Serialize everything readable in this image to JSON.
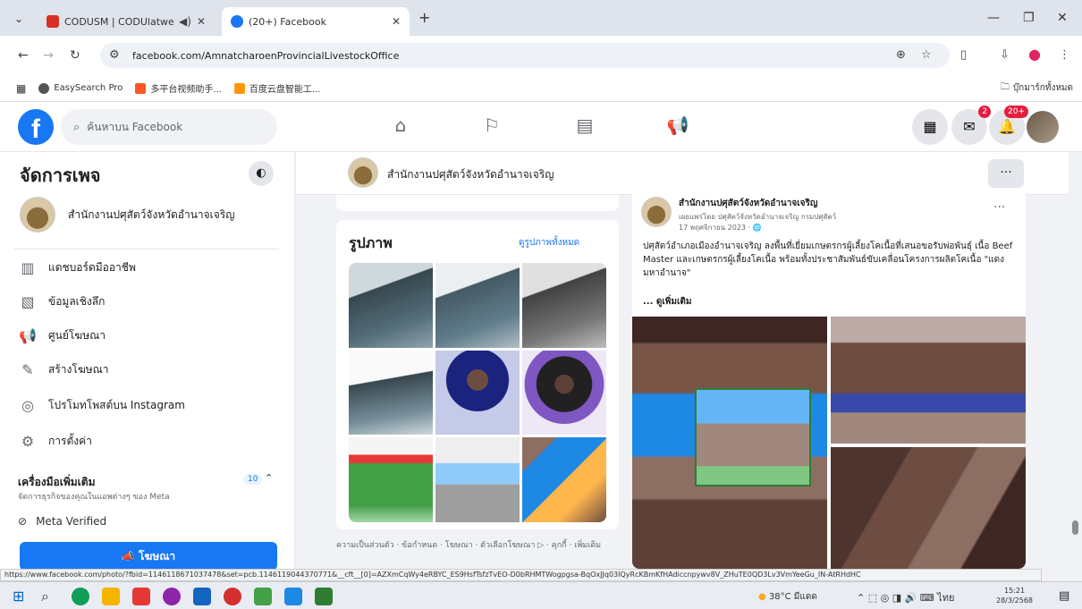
{
  "browser": {
    "tabs": [
      {
        "title": "CODUSM | CODUlatwerku",
        "audio_icon": "speaker-icon"
      },
      {
        "title": "(20+) Facebook"
      }
    ],
    "url": "facebook.com/AmnatcharoenProvincialLivestockOffice",
    "bookmarks": [
      "EasySearch Pro",
      "多平台视频助手...",
      "百度云盘智能工..."
    ],
    "all_bookmarks": "บุ๊กมาร์กทั้งหมด",
    "status_url": "https://www.facebook.com/photo/?fbid=1146118671037478&set=pcb.1146119044370771&__cft__[0]=AZXmCqWy4eRBYC_ES9HsfTsfzTvEO-D0bRHMTWogpgsa-BqOxJJq03IQyRcKBmKfHAdiccnpywv8V_ZHuTE0QD3Lv3VmYeeGu_IN-AtRHdHC"
  },
  "fb": {
    "search_placeholder": "ค้นหาบน Facebook",
    "messenger_badge": "2",
    "notif_badge": "20+"
  },
  "left": {
    "title": "จัดการเพจ",
    "page_name": "สำนักงานปศุสัตว์จังหวัดอำนาจเจริญ",
    "items": [
      {
        "label": "แดชบอร์ดมืออาชีพ",
        "icon": "dashboard-icon"
      },
      {
        "label": "ข้อมูลเชิงลึก",
        "icon": "insights-icon"
      },
      {
        "label": "ศูนย์โฆษณา",
        "icon": "megaphone-icon"
      },
      {
        "label": "สร้างโฆษณา",
        "icon": "edit-icon"
      },
      {
        "label": "โปรโมทโพสต์บน Instagram",
        "icon": "instagram-icon"
      },
      {
        "label": "การตั้งค่า",
        "icon": "gear-icon"
      }
    ],
    "section_title": "เครื่องมือเพิ่มเติม",
    "section_sub": "จัดการธุรกิจของคุณในแอพต่างๆ ของ Meta",
    "section_count": "10",
    "meta_verified": "Meta Verified",
    "ad_button": "โฆษณา"
  },
  "main": {
    "page_name": "สำนักงานปศุสัตว์จังหวัดอำนาจเจริญ",
    "photos_title": "รูปภาพ",
    "photos_all": "ดูรูปภาพทั้งหมด",
    "footer_links": "ความเป็นส่วนตัว · ข้อกำหนด · โฆษณา · ตัวเลือกโฆษณา ▷ · คุกกี้ · เพิ่มเติม"
  },
  "post": {
    "author": "สำนักงานปศุสัตว์จังหวัดอำนาจเจริญ",
    "subline": "เผยแพร่โดย ปศุสัตว์จังหวัดอำนาจเจริญ กรมปศุสัตว์",
    "date": "17 พฤศจิกายน 2023 · ",
    "text": "ปศุสัตว์อำเภอเมืองอำนาจเจริญ ลงพื้นที่เยี่ยมเกษตรกรผู้เลี้ยงโคเนื้อที่เสนอขอรับพ่อพันธุ์ เนื้อ Beef Master และเกษตรกรผู้เลี้ยงโคเนื้อ พร้อมทั้งประชาสัมพันธ์ขับเคลื่อนโครงการผลิตโคเนื้อ \"แดงมหาอำนาจ\"",
    "see_more": "... ดูเพิ่มเติม"
  },
  "taskbar": {
    "weather": "38°C มีแดด",
    "lang": "ไทย",
    "time": "15:21",
    "date": "28/3/2568"
  }
}
